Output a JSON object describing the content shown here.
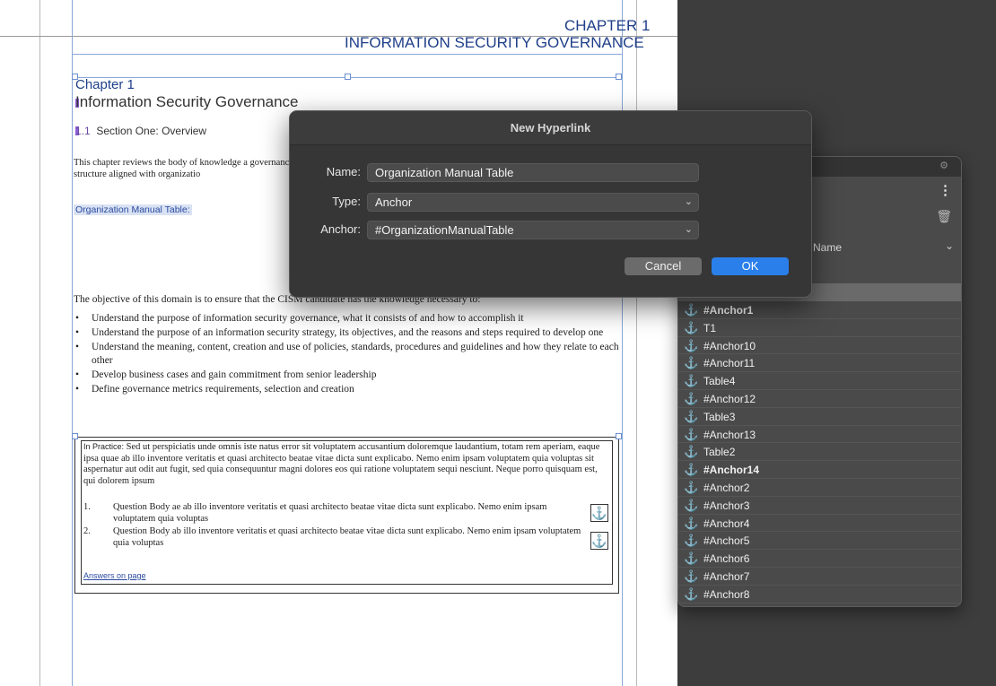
{
  "document": {
    "running_head": {
      "chapter": "CHAPTER 1",
      "title": "INFORMATION SECURITY GOVERNANCE"
    },
    "chapter_label": "Chapter 1",
    "chapter_title": "Information Security Governance",
    "section": {
      "number": "1.1",
      "title": "Section One: Overview"
    },
    "intro_paragraph": "This chapter reviews the body of knowledge a governance structure aligned with organizatio",
    "hyperlink_target_text": "Organization Manual Table:",
    "objective": "The objective of this domain is to ensure that the CISM candidate has the knowledge necessary to:",
    "bullets": [
      "Understand the purpose of information security governance, what it consists of and how to accomplish it",
      "Understand the purpose of an information security strategy, its objectives, and the reasons and steps required to develop one",
      "Understand the meaning, content, creation and use of policies, standards, procedures and guidelines and how they relate to each other",
      "Develop business cases and gain commitment from senior leadership",
      "Define governance metrics requirements, selection and creation"
    ],
    "practice": {
      "label": "In Practice:",
      "text": "Sed ut perspiciatis unde omnis iste natus error sit voluptatem accusantium doloremque laudantium, totam rem aperiam, eaque ipsa quae ab illo inventore veritatis et quasi architecto beatae vitae dicta sunt explicabo. Nemo enim ipsam voluptatem quia voluptas sit aspernatur aut odit aut fugit, sed quia consequuntur magni dolores eos qui ratione voluptatem sequi nesciunt. Neque porro quisquam est, qui dolorem ipsum",
      "questions": [
        {
          "num": "1.",
          "text": "Question Body ae ab illo inventore veritatis et quasi architecto beatae vitae dicta sunt explicabo. Nemo enim ipsam voluptatem quia voluptas"
        },
        {
          "num": "2.",
          "text": "Question Body ab illo inventore veritatis et quasi architecto beatae vitae dicta sunt explicabo. Nemo enim ipsam voluptatem quia voluptas"
        }
      ],
      "answers_link": "Answers on page"
    },
    "anchor_glyph": "⚓"
  },
  "dialog": {
    "title": "New Hyperlink",
    "name_label": "Name:",
    "name_value": "Organization Manual Table",
    "type_label": "Type:",
    "type_value": "Anchor",
    "anchor_label": "Anchor:",
    "anchor_value": "#OrganizationManualTable",
    "cancel_label": "Cancel",
    "ok_label": "OK",
    "accent_color": "#2a7fea"
  },
  "anchors_panel": {
    "sort_label": "Name",
    "icon": "anchor-icon",
    "items": [
      {
        "label": "#Anchor1",
        "bold": true
      },
      {
        "label": "T1",
        "bold": false
      },
      {
        "label": "#Anchor10",
        "bold": false
      },
      {
        "label": "#Anchor11",
        "bold": false
      },
      {
        "label": "Table4",
        "bold": false
      },
      {
        "label": "#Anchor12",
        "bold": false
      },
      {
        "label": "Table3",
        "bold": false
      },
      {
        "label": "#Anchor13",
        "bold": false
      },
      {
        "label": "Table2",
        "bold": false
      },
      {
        "label": "#Anchor14",
        "bold": true
      },
      {
        "label": "#Anchor2",
        "bold": false
      },
      {
        "label": "#Anchor3",
        "bold": false
      },
      {
        "label": "#Anchor4",
        "bold": false
      },
      {
        "label": "#Anchor5",
        "bold": false
      },
      {
        "label": "#Anchor6",
        "bold": false
      },
      {
        "label": "#Anchor7",
        "bold": false
      },
      {
        "label": "#Anchor8",
        "bold": false
      }
    ]
  }
}
